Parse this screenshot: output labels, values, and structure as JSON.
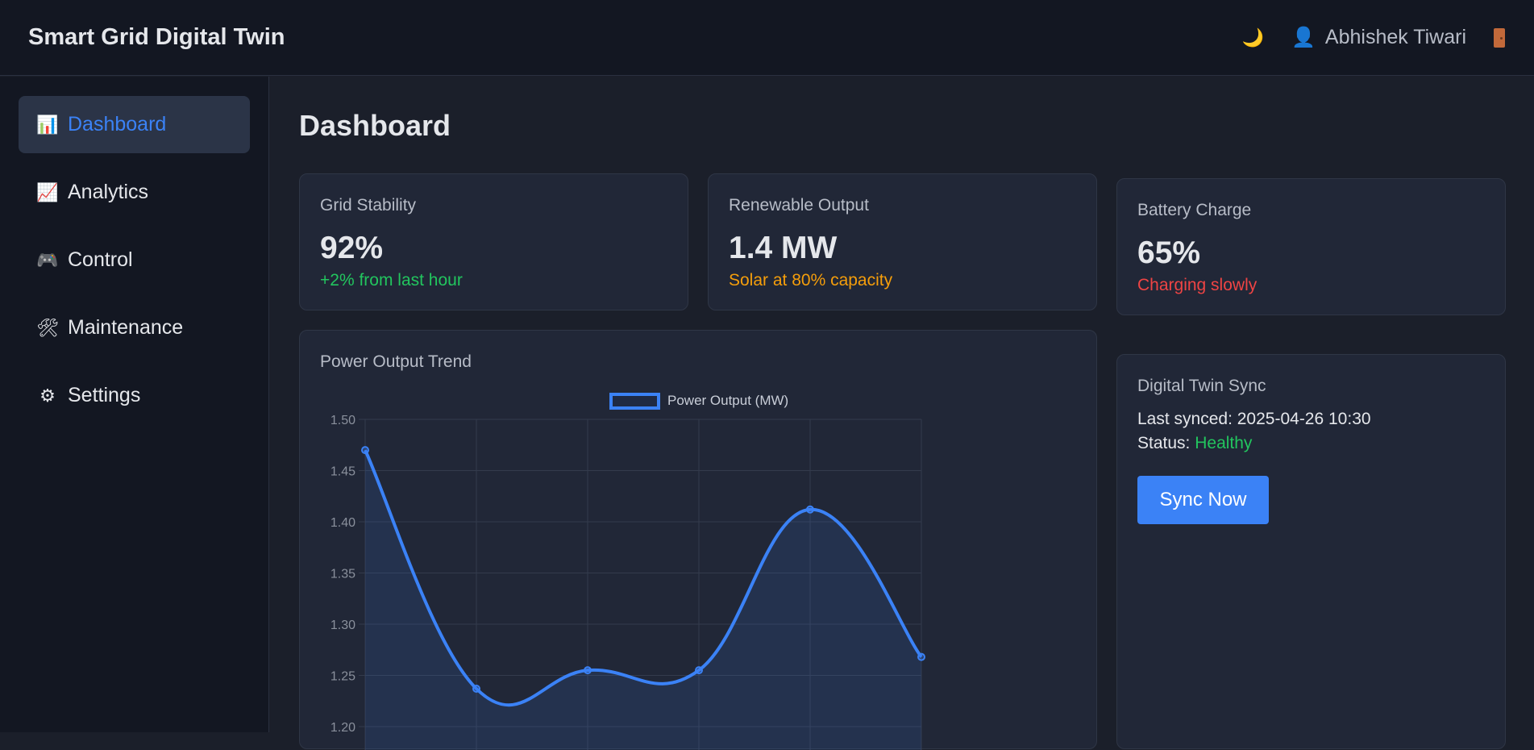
{
  "header": {
    "title": "Smart Grid Digital Twin",
    "user_name": "Abhishek Tiwari",
    "theme_icon": "🌙",
    "user_icon": "👤"
  },
  "sidebar": {
    "items": [
      {
        "icon": "📊",
        "label": "Dashboard",
        "active": true
      },
      {
        "icon": "📈",
        "label": "Analytics"
      },
      {
        "icon": "🎮",
        "label": "Control"
      },
      {
        "icon": "🛠",
        "label": "Maintenance"
      },
      {
        "icon": "⚙",
        "label": "Settings"
      }
    ]
  },
  "main": {
    "page_title": "Dashboard",
    "stats": [
      {
        "label": "Grid Stability",
        "value": "92%",
        "note": "+2% from last hour",
        "note_color": "#22c55e"
      },
      {
        "label": "Renewable Output",
        "value": "1.4 MW",
        "note": "Solar at 80% capacity",
        "note_color": "#f59e0b"
      },
      {
        "label": "Battery Charge",
        "value": "65%",
        "note": "Charging slowly",
        "note_color": "#ef4444"
      }
    ],
    "sync": {
      "title": "Digital Twin Sync",
      "last_synced_label": "Last synced:",
      "last_synced_value": "2025-04-26 10:30",
      "status_label": "Status:",
      "status_value": "Healthy",
      "status_color": "#22c55e",
      "button_label": "Sync Now"
    }
  },
  "chart_data": {
    "type": "line",
    "title": "Power Output Trend",
    "series": [
      {
        "name": "Power Output (MW)",
        "values": [
          1.47,
          1.237,
          1.255,
          1.255,
          1.412,
          1.268
        ],
        "color": "#3b82f6"
      }
    ],
    "ylim": [
      1.2,
      1.5
    ],
    "y_ticks": [
      "1.50",
      "1.45",
      "1.40",
      "1.35",
      "1.30",
      "1.25",
      "1.20"
    ],
    "grid": true,
    "legend": "top-center",
    "fill": true
  }
}
